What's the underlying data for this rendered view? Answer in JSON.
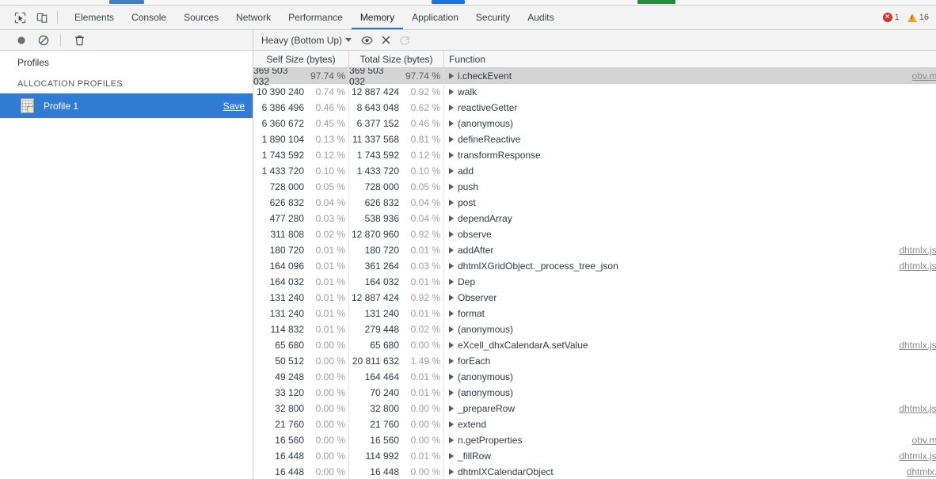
{
  "window": {
    "page_sliver_colors": [
      "#3b82c4",
      "#1a73e8",
      "#1e8e3e"
    ]
  },
  "tabbar": {
    "left_icons": [
      {
        "name": "inspect-element-icon",
        "title": "Inspect element"
      },
      {
        "name": "device-toolbar-icon",
        "title": "Toggle device toolbar"
      }
    ],
    "tabs": [
      {
        "label": "Elements",
        "active": false
      },
      {
        "label": "Console",
        "active": false
      },
      {
        "label": "Sources",
        "active": false
      },
      {
        "label": "Network",
        "active": false
      },
      {
        "label": "Performance",
        "active": false
      },
      {
        "label": "Memory",
        "active": true
      },
      {
        "label": "Application",
        "active": false
      },
      {
        "label": "Security",
        "active": false
      },
      {
        "label": "Audits",
        "active": false
      }
    ],
    "error_count": "1",
    "warning_count": "16",
    "accent_color": "#1a73e8",
    "error_color": "#d93025",
    "warning_color": "#f5a623"
  },
  "toolbar": {
    "record_label": "Record",
    "clear_label": "Clear",
    "delete_label": "Delete",
    "view_select_value": "Heavy (Bottom Up)",
    "focus_label": "Focus selected function",
    "exclude_label": "Exclude selected function",
    "restore_label": "Restore all functions"
  },
  "sidebar": {
    "title": "Profiles",
    "section_label": "ALLOCATION PROFILES",
    "profile": {
      "name": "Profile 1",
      "save_label": "Save",
      "selected": true
    },
    "selected_color": "#2f7bd6"
  },
  "table": {
    "columns": [
      {
        "key": "self",
        "label": "Self Size (bytes)"
      },
      {
        "key": "total",
        "label": "Total Size (bytes)"
      },
      {
        "key": "function",
        "label": "Function"
      }
    ],
    "rows": [
      {
        "self": "369 503 032",
        "self_pct": "97.74 %",
        "total": "369 503 032",
        "total_pct": "97.74 %",
        "function": "i.checkEvent",
        "source": "obv.mi",
        "selected": true
      },
      {
        "self": "10 390 240",
        "self_pct": "0.74 %",
        "total": "12 887 424",
        "total_pct": "0.92 %",
        "function": "walk",
        "source": "",
        "selected": false
      },
      {
        "self": "6 386 496",
        "self_pct": "0.46 %",
        "total": "8 643 048",
        "total_pct": "0.62 %",
        "function": "reactiveGetter",
        "source": "",
        "selected": false
      },
      {
        "self": "6 360 672",
        "self_pct": "0.45 %",
        "total": "6 377 152",
        "total_pct": "0.46 %",
        "function": "(anonymous)",
        "source": "",
        "selected": false
      },
      {
        "self": "1 890 104",
        "self_pct": "0.13 %",
        "total": "11 337 568",
        "total_pct": "0.81 %",
        "function": "defineReactive",
        "source": "",
        "selected": false
      },
      {
        "self": "1 743 592",
        "self_pct": "0.12 %",
        "total": "1 743 592",
        "total_pct": "0.12 %",
        "function": "transformResponse",
        "source": "",
        "selected": false
      },
      {
        "self": "1 433 720",
        "self_pct": "0.10 %",
        "total": "1 433 720",
        "total_pct": "0.10 %",
        "function": "add",
        "source": "",
        "selected": false
      },
      {
        "self": "728 000",
        "self_pct": "0.05 %",
        "total": "728 000",
        "total_pct": "0.05 %",
        "function": "push",
        "source": "",
        "selected": false
      },
      {
        "self": "626 832",
        "self_pct": "0.04 %",
        "total": "626 832",
        "total_pct": "0.04 %",
        "function": "post",
        "source": "",
        "selected": false
      },
      {
        "self": "477 280",
        "self_pct": "0.03 %",
        "total": "538 936",
        "total_pct": "0.04 %",
        "function": "dependArray",
        "source": "",
        "selected": false
      },
      {
        "self": "311 808",
        "self_pct": "0.02 %",
        "total": "12 870 960",
        "total_pct": "0.92 %",
        "function": "observe",
        "source": "",
        "selected": false
      },
      {
        "self": "180 720",
        "self_pct": "0.01 %",
        "total": "180 720",
        "total_pct": "0.01 %",
        "function": "addAfter",
        "source": "dhtmlx.js:",
        "selected": false
      },
      {
        "self": "164 096",
        "self_pct": "0.01 %",
        "total": "361 264",
        "total_pct": "0.03 %",
        "function": "dhtmlXGridObject._process_tree_json",
        "source": "dhtmlx.js:",
        "selected": false
      },
      {
        "self": "164 032",
        "self_pct": "0.01 %",
        "total": "164 032",
        "total_pct": "0.01 %",
        "function": "Dep",
        "source": "",
        "selected": false
      },
      {
        "self": "131 240",
        "self_pct": "0.01 %",
        "total": "12 887 424",
        "total_pct": "0.92 %",
        "function": "Observer",
        "source": "",
        "selected": false
      },
      {
        "self": "131 240",
        "self_pct": "0.01 %",
        "total": "131 240",
        "total_pct": "0.01 %",
        "function": "format",
        "source": "",
        "selected": false
      },
      {
        "self": "114 832",
        "self_pct": "0.01 %",
        "total": "279 448",
        "total_pct": "0.02 %",
        "function": "(anonymous)",
        "source": "",
        "selected": false
      },
      {
        "self": "65 680",
        "self_pct": "0.00 %",
        "total": "65 680",
        "total_pct": "0.00 %",
        "function": "eXcell_dhxCalendarA.setValue",
        "source": "dhtmlx.js:",
        "selected": false
      },
      {
        "self": "50 512",
        "self_pct": "0.00 %",
        "total": "20 811 632",
        "total_pct": "1.49 %",
        "function": "forEach",
        "source": "",
        "selected": false
      },
      {
        "self": "49 248",
        "self_pct": "0.00 %",
        "total": "164 464",
        "total_pct": "0.01 %",
        "function": "(anonymous)",
        "source": "",
        "selected": false
      },
      {
        "self": "33 120",
        "self_pct": "0.00 %",
        "total": "70 240",
        "total_pct": "0.01 %",
        "function": "(anonymous)",
        "source": "",
        "selected": false
      },
      {
        "self": "32 800",
        "self_pct": "0.00 %",
        "total": "32 800",
        "total_pct": "0.00 %",
        "function": "_prepareRow",
        "source": "dhtmlx.js:",
        "selected": false
      },
      {
        "self": "21 760",
        "self_pct": "0.00 %",
        "total": "21 760",
        "total_pct": "0.00 %",
        "function": "extend",
        "source": "",
        "selected": false
      },
      {
        "self": "16 560",
        "self_pct": "0.00 %",
        "total": "16 560",
        "total_pct": "0.00 %",
        "function": "n.getProperties",
        "source": "obv.mi",
        "selected": false
      },
      {
        "self": "16 448",
        "self_pct": "0.00 %",
        "total": "114 992",
        "total_pct": "0.01 %",
        "function": "_fillRow",
        "source": "dhtmlx.js:",
        "selected": false
      },
      {
        "self": "16 448",
        "self_pct": "0.00 %",
        "total": "16 448",
        "total_pct": "0.00 %",
        "function": "dhtmlXCalendarObject",
        "source": "dhtmlx.j",
        "selected": false
      }
    ]
  }
}
